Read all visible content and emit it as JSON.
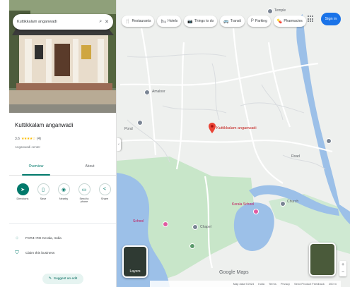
{
  "search": {
    "query": "Kuttikkalam anganwadi"
  },
  "place": {
    "name": "Kuttikkalam anganwadi",
    "rating": "3.6",
    "stars": "★★★★☆",
    "review_count": "(4)",
    "category": "Anganwadi center",
    "tabs": [
      "Overview",
      "About"
    ],
    "actions": [
      {
        "label": "Directions",
        "icon": "directions-icon"
      },
      {
        "label": "Save",
        "icon": "bookmark-icon"
      },
      {
        "label": "Nearby",
        "icon": "nearby-icon"
      },
      {
        "label": "Send to phone",
        "icon": "phone-icon"
      },
      {
        "label": "Share",
        "icon": "share-icon"
      }
    ],
    "plus_code": "FCR4+RG Kerala, India",
    "ownership": "Claim this business",
    "suggest_edit": "Suggest an edit"
  },
  "map": {
    "chips": [
      {
        "label": "Restaurants",
        "icon": "fork-icon"
      },
      {
        "label": "Hotels",
        "icon": "bed-icon"
      },
      {
        "label": "Things to do",
        "icon": "camera-icon"
      },
      {
        "label": "Transit",
        "icon": "bus-icon"
      },
      {
        "label": "Parking",
        "icon": "parking-icon"
      },
      {
        "label": "Pharmacies",
        "icon": "pill-icon"
      }
    ],
    "sign_in": "Sign in",
    "pin_label": "Kuttikkalam anganwadi",
    "labels": {
      "amaloor": "Amaloor",
      "pond": "Pond",
      "temple": "Temple",
      "school": "School",
      "church": "Church",
      "kerala_school": "Kerala School",
      "chapel": "Chapel",
      "road": "Road"
    },
    "layers_label": "Layers",
    "google": "Google Maps",
    "footer": [
      "Map data ©2024",
      "India",
      "Terms",
      "Privacy",
      "Send Product Feedback",
      "200 m"
    ]
  }
}
